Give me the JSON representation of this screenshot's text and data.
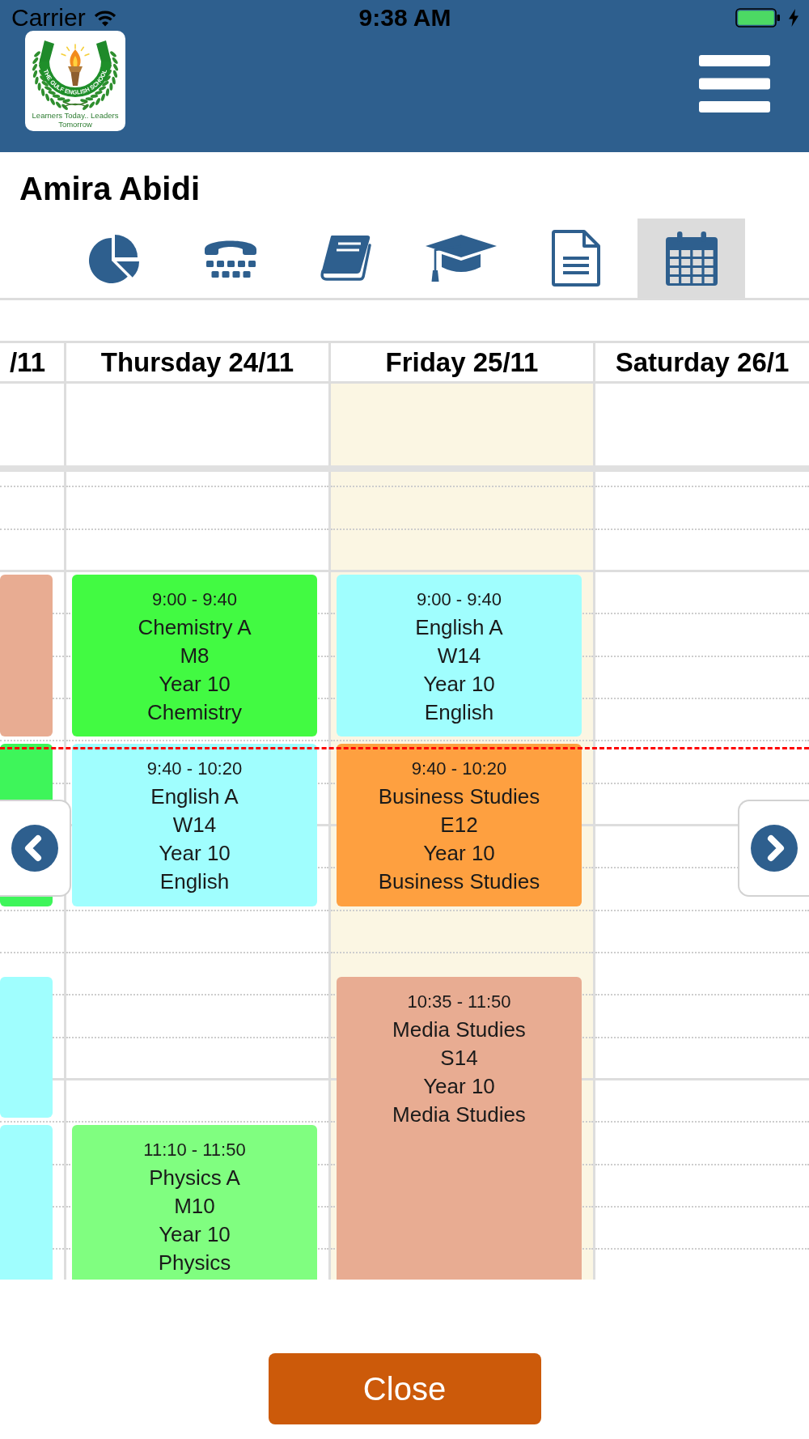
{
  "status_bar": {
    "carrier": "Carrier",
    "time": "9:38 AM"
  },
  "header": {
    "logo": {
      "name": "THE GULF ENGLISH SCHOOL",
      "tagline": "Learners Today.. Leaders Tomorrow"
    }
  },
  "student": {
    "name": "Amira Abidi"
  },
  "tabs": [
    {
      "selected": false
    },
    {
      "selected": false
    },
    {
      "selected": false
    },
    {
      "selected": false
    },
    {
      "selected": false
    },
    {
      "selected": true
    }
  ],
  "calendar": {
    "days": [
      {
        "label": "/11",
        "today": false,
        "events": [
          {
            "color": "#e8ac92"
          },
          {
            "color": "#3ef55a"
          },
          {
            "color": "#a0fefe"
          },
          {
            "color": "#a0fefe"
          }
        ]
      },
      {
        "label": "Thursday 24/11",
        "today": false,
        "events": [
          {
            "time": "9:00 - 9:40",
            "title": "Chemistry A",
            "room": "M8",
            "group": "Year 10",
            "subject": "Chemistry",
            "color": "#42fa42"
          },
          {
            "time": "9:40 - 10:20",
            "title": "English A",
            "room": "W14",
            "group": "Year 10",
            "subject": "English",
            "color": "#a0fefe"
          },
          {
            "time": "11:10 - 11:50",
            "title": "Physics A",
            "room": "M10",
            "group": "Year 10",
            "subject": "Physics",
            "color": "#80fe80"
          }
        ]
      },
      {
        "label": "Friday 25/11",
        "today": true,
        "events": [
          {
            "time": "9:00 - 9:40",
            "title": "English A",
            "room": "W14",
            "group": "Year 10",
            "subject": "English",
            "color": "#a0fefe"
          },
          {
            "time": "9:40 - 10:20",
            "title": "Business Studies",
            "room": "E12",
            "group": "Year 10",
            "subject": "Business Studies",
            "color": "#fea040"
          },
          {
            "time": "10:35 - 11:50",
            "title": "Media Studies",
            "room": "S14",
            "group": "Year 10",
            "subject": "Media Studies",
            "color": "#e8ac92"
          }
        ]
      },
      {
        "label": "Saturday 26/1",
        "today": false
      }
    ]
  },
  "close_button": {
    "label": "Close"
  }
}
